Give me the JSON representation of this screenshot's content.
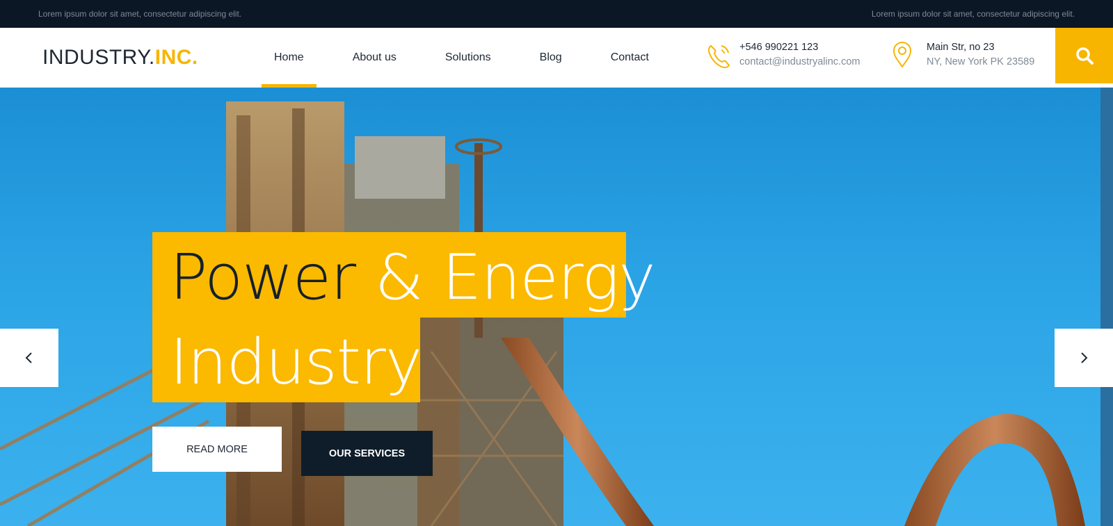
{
  "topbar": {
    "left_text": "Lorem ipsum dolor sit amet, consectetur adipiscing elit.",
    "right_text": "Lorem ipsum dolor sit amet, consectetur adipiscing elit."
  },
  "header": {
    "logo_main": "INDUSTRY.",
    "logo_accent": "INC.",
    "nav": [
      {
        "label": "Home",
        "active": true
      },
      {
        "label": "About us",
        "active": false
      },
      {
        "label": "Solutions",
        "active": false
      },
      {
        "label": "Blog",
        "active": false
      },
      {
        "label": "Contact",
        "active": false
      }
    ],
    "phone": {
      "icon": "phone-icon",
      "line1": "+546 990221 123",
      "line2": "contact@industryalinc.com"
    },
    "address": {
      "icon": "map-pin-icon",
      "line1": "Main Str, no 23",
      "line2": "NY, New York PK 23589"
    },
    "search_icon": "search-icon"
  },
  "hero": {
    "headline_dark": "Power",
    "headline_light": " & Energy",
    "headline_line2": "Industry",
    "read_more_label": "READ MORE",
    "our_services_label": "OUR SERVICES",
    "prev_icon": "chevron-left-icon",
    "next_icon": "chevron-right-icon"
  },
  "colors": {
    "accent": "#f7b500",
    "dark": "#0b1724",
    "sky": "#2ba4e6"
  }
}
